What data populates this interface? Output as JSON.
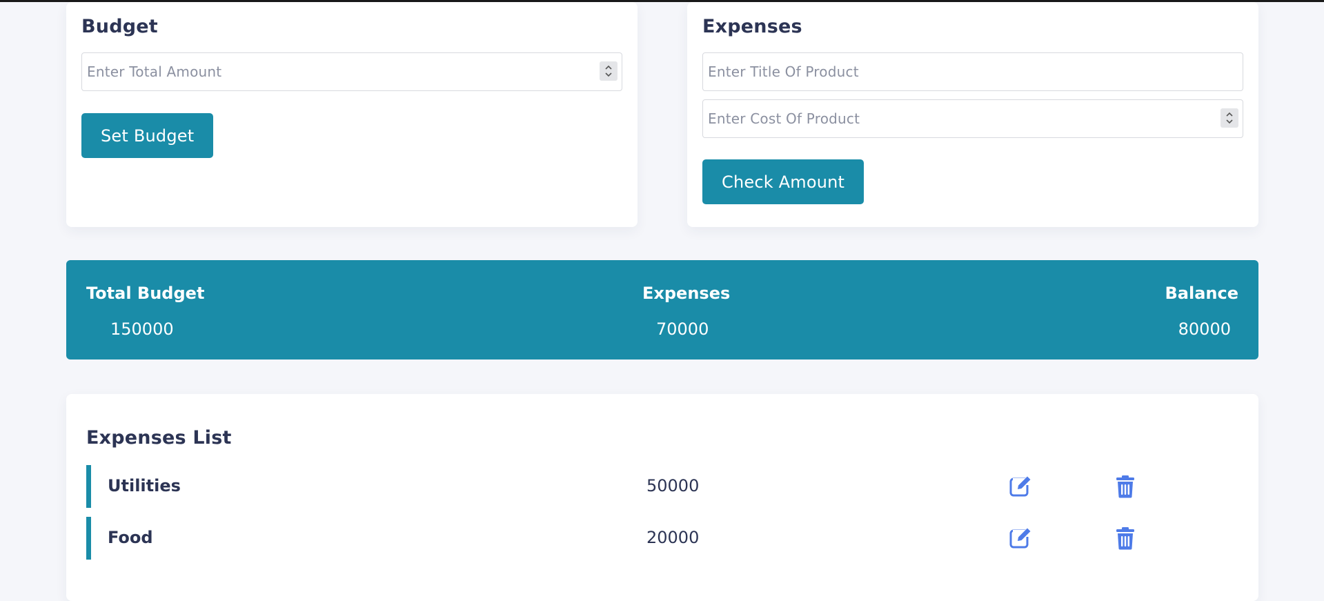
{
  "budget": {
    "heading": "Budget",
    "total_placeholder": "Enter Total Amount",
    "set_button": "Set Budget"
  },
  "expenses_form": {
    "heading": "Expenses",
    "title_placeholder": "Enter Title Of Product",
    "cost_placeholder": "Enter Cost Of Product",
    "check_button": "Check Amount"
  },
  "summary": {
    "total_budget_label": "Total Budget",
    "total_budget_value": "150000",
    "expenses_label": "Expenses",
    "expenses_value": "70000",
    "balance_label": "Balance",
    "balance_value": "80000"
  },
  "expenses_list": {
    "heading": "Expenses List",
    "items": [
      {
        "title": "Utilities",
        "amount": "50000",
        "edit_icon": "edit-icon",
        "delete_icon": "trash-icon"
      },
      {
        "title": "Food",
        "amount": "20000",
        "edit_icon": "edit-icon",
        "delete_icon": "trash-icon"
      }
    ]
  },
  "colors": {
    "accent": "#1a8ca8",
    "icon": "#4e7be8",
    "text": "#2c3454",
    "background": "#f5f6fa"
  }
}
